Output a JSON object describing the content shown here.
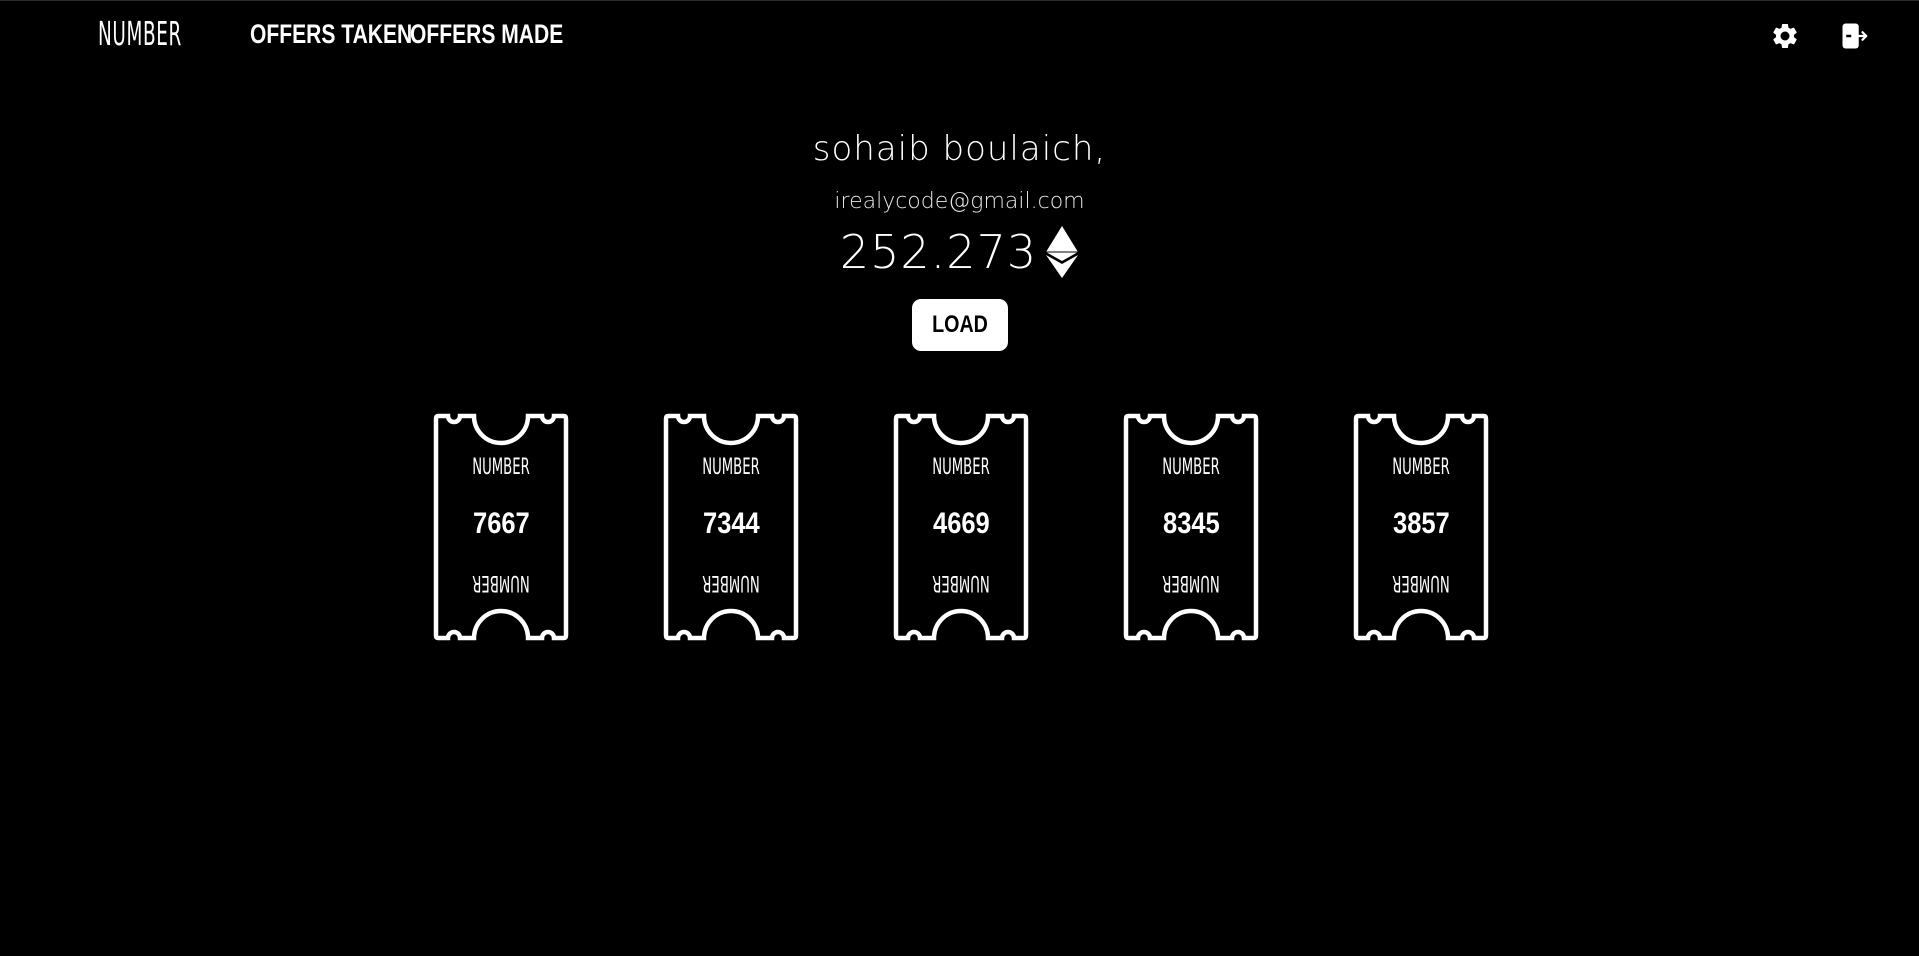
{
  "navbar": {
    "logo": "NUMBER",
    "links": [
      {
        "label": "OFFERS TAKEN"
      },
      {
        "label": "OFFERS MADE"
      }
    ],
    "icons": {
      "settings": "gear-icon",
      "logout": "logout-icon"
    }
  },
  "profile": {
    "name": "sohaib boulaich,",
    "email": "irealycode@gmail.com",
    "balance": "252.273",
    "currency_icon": "ethereum-icon"
  },
  "load_button": {
    "label": "LOAD"
  },
  "tickets": [
    {
      "brand": "NUMBER",
      "number": "7667"
    },
    {
      "brand": "NUMBER",
      "number": "7344"
    },
    {
      "brand": "NUMBER",
      "number": "4669"
    },
    {
      "brand": "NUMBER",
      "number": "8345"
    },
    {
      "brand": "NUMBER",
      "number": "3857"
    }
  ],
  "colors": {
    "background": "#000000",
    "foreground": "#ffffff"
  }
}
